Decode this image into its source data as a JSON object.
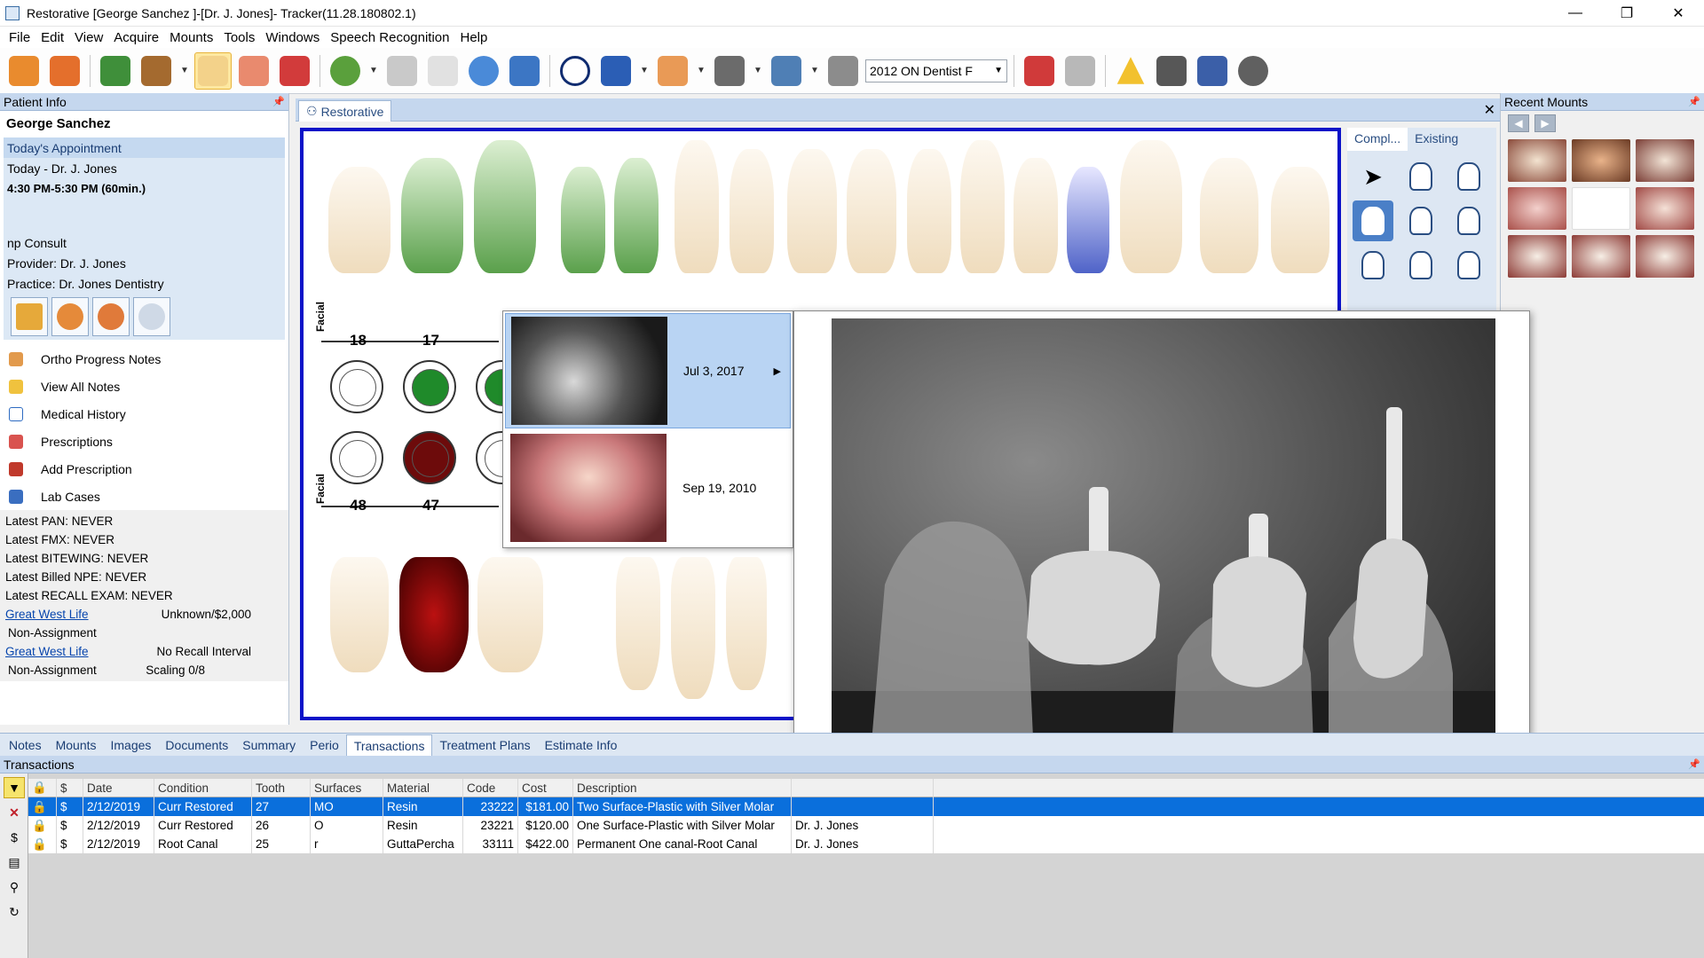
{
  "window": {
    "title": "Restorative  [George Sanchez ]-[Dr. J. Jones]- Tracker(11.28.180802.1)",
    "minimize": "—",
    "maximize": "❐",
    "close": "✕"
  },
  "menu": [
    "File",
    "Edit",
    "View",
    "Acquire",
    "Mounts",
    "Tools",
    "Windows",
    "Speech Recognition",
    "Help"
  ],
  "toolbar": {
    "provider_select": "2012 ON Dentist F"
  },
  "patient_panel": {
    "header": "Patient Info",
    "name": "George Sanchez",
    "appointment_title": "Today's Appointment",
    "appointment_line": "Today - Dr. J. Jones",
    "appointment_time": "4:30 PM-5:30 PM (60min.)",
    "appointment_type": "np Consult",
    "provider": "Provider: Dr. J. Jones",
    "practice": "Practice: Dr. Jones Dentistry",
    "actions": [
      "Ortho Progress Notes",
      "View All Notes",
      "Medical History",
      "Prescriptions",
      "Add Prescription",
      "Lab Cases"
    ],
    "latest": [
      "Latest PAN: NEVER",
      "Latest FMX: NEVER",
      "Latest BITEWING: NEVER",
      "Latest Billed NPE: NEVER",
      "Latest RECALL EXAM: NEVER"
    ],
    "insurance": [
      {
        "name": "Great West Life",
        "value": "Unknown/$2,000",
        "assign": "Non-Assignment",
        "assign_value": ""
      },
      {
        "name": "Great West Life",
        "value": "No Recall Interval",
        "assign": "Non-Assignment",
        "assign_value": "Scaling 0/8"
      }
    ]
  },
  "document": {
    "tab": "Restorative",
    "facial_label": "Facial",
    "upper_numbers": [
      "18",
      "17"
    ],
    "lower_numbers": [
      "48",
      "47"
    ],
    "tool_tabs": [
      "Compl...",
      "Existing"
    ]
  },
  "image_popup": {
    "items": [
      {
        "date": "Jul 3, 2017",
        "arrow": "▶"
      },
      {
        "date": "Sep 19, 2010",
        "arrow": ""
      }
    ]
  },
  "recent_mounts": {
    "header": "Recent Mounts"
  },
  "bottom_tabs": [
    "Notes",
    "Mounts",
    "Images",
    "Documents",
    "Summary",
    "Perio",
    "Transactions",
    "Treatment Plans",
    "Estimate Info"
  ],
  "active_bottom_tab": "Transactions",
  "transactions": {
    "header": "Transactions",
    "columns": [
      "Date",
      "Condition",
      "Tooth",
      "Surfaces",
      "Material",
      "Code",
      "Cost",
      "Description"
    ],
    "rows": [
      {
        "date": "2/12/2019",
        "condition": "Curr Restored",
        "tooth": "27",
        "surfaces": "MO",
        "material": "Resin",
        "code": "23222",
        "cost": "$181.00",
        "description": "Two Surface-Plastic with Silver Molar",
        "provider": ""
      },
      {
        "date": "2/12/2019",
        "condition": "Curr Restored",
        "tooth": "26",
        "surfaces": "O",
        "material": "Resin",
        "code": "23221",
        "cost": "$120.00",
        "description": "One Surface-Plastic with Silver Molar",
        "provider": "Dr. J. Jones"
      },
      {
        "date": "2/12/2019",
        "condition": "Root Canal",
        "tooth": "25",
        "surfaces": "r",
        "material": "GuttaPercha",
        "code": "33111",
        "cost": "$422.00",
        "description": "Permanent One canal-Root Canal",
        "provider": "Dr. J. Jones"
      }
    ]
  },
  "colors": {
    "accent": "#0a12c8",
    "selection": "#0a6fdc",
    "panel": "#c5d7ee"
  }
}
